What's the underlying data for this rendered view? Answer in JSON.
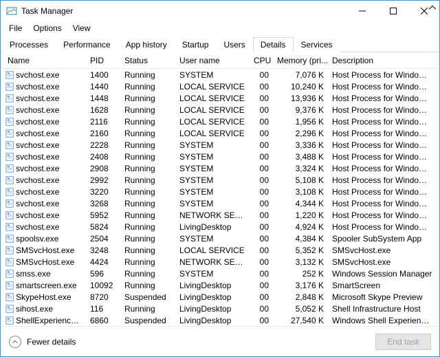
{
  "window": {
    "title": "Task Manager"
  },
  "menu": {
    "file": "File",
    "options": "Options",
    "view": "View"
  },
  "tabs": {
    "processes": "Processes",
    "performance": "Performance",
    "app_history": "App history",
    "startup": "Startup",
    "users": "Users",
    "details": "Details",
    "services": "Services"
  },
  "columns": {
    "name": "Name",
    "pid": "PID",
    "status": "Status",
    "user": "User name",
    "cpu": "CPU",
    "memory": "Memory (pri...",
    "description": "Description"
  },
  "footer": {
    "fewer": "Fewer details",
    "end_task": "End task"
  },
  "processes": [
    {
      "name": "svchost.exe",
      "pid": "1400",
      "status": "Running",
      "user": "SYSTEM",
      "cpu": "00",
      "mem": "7,076 K",
      "desc": "Host Process for Windows Serv"
    },
    {
      "name": "svchost.exe",
      "pid": "1440",
      "status": "Running",
      "user": "LOCAL SERVICE",
      "cpu": "00",
      "mem": "10,240 K",
      "desc": "Host Process for Windows Serv"
    },
    {
      "name": "svchost.exe",
      "pid": "1448",
      "status": "Running",
      "user": "LOCAL SERVICE",
      "cpu": "00",
      "mem": "13,936 K",
      "desc": "Host Process for Windows Serv"
    },
    {
      "name": "svchost.exe",
      "pid": "1628",
      "status": "Running",
      "user": "LOCAL SERVICE",
      "cpu": "00",
      "mem": "9,376 K",
      "desc": "Host Process for Windows Serv"
    },
    {
      "name": "svchost.exe",
      "pid": "2116",
      "status": "Running",
      "user": "LOCAL SERVICE",
      "cpu": "00",
      "mem": "1,956 K",
      "desc": "Host Process for Windows Serv"
    },
    {
      "name": "svchost.exe",
      "pid": "2160",
      "status": "Running",
      "user": "LOCAL SERVICE",
      "cpu": "00",
      "mem": "2,296 K",
      "desc": "Host Process for Windows Serv"
    },
    {
      "name": "svchost.exe",
      "pid": "2228",
      "status": "Running",
      "user": "SYSTEM",
      "cpu": "00",
      "mem": "3,336 K",
      "desc": "Host Process for Windows Serv"
    },
    {
      "name": "svchost.exe",
      "pid": "2408",
      "status": "Running",
      "user": "SYSTEM",
      "cpu": "00",
      "mem": "3,488 K",
      "desc": "Host Process for Windows Serv"
    },
    {
      "name": "svchost.exe",
      "pid": "2908",
      "status": "Running",
      "user": "SYSTEM",
      "cpu": "00",
      "mem": "3,324 K",
      "desc": "Host Process for Windows Serv"
    },
    {
      "name": "svchost.exe",
      "pid": "2992",
      "status": "Running",
      "user": "SYSTEM",
      "cpu": "00",
      "mem": "5,108 K",
      "desc": "Host Process for Windows Serv"
    },
    {
      "name": "svchost.exe",
      "pid": "3220",
      "status": "Running",
      "user": "SYSTEM",
      "cpu": "00",
      "mem": "3,108 K",
      "desc": "Host Process for Windows Serv"
    },
    {
      "name": "svchost.exe",
      "pid": "3268",
      "status": "Running",
      "user": "SYSTEM",
      "cpu": "00",
      "mem": "4,344 K",
      "desc": "Host Process for Windows Serv"
    },
    {
      "name": "svchost.exe",
      "pid": "5952",
      "status": "Running",
      "user": "NETWORK SERVICE",
      "cpu": "00",
      "mem": "1,220 K",
      "desc": "Host Process for Windows Serv"
    },
    {
      "name": "svchost.exe",
      "pid": "5824",
      "status": "Running",
      "user": "LivingDesktop",
      "cpu": "00",
      "mem": "4,924 K",
      "desc": "Host Process for Windows Serv"
    },
    {
      "name": "spoolsv.exe",
      "pid": "2504",
      "status": "Running",
      "user": "SYSTEM",
      "cpu": "00",
      "mem": "4,384 K",
      "desc": "Spooler SubSystem App"
    },
    {
      "name": "SMSvcHost.exe",
      "pid": "3248",
      "status": "Running",
      "user": "LOCAL SERVICE",
      "cpu": "00",
      "mem": "5,352 K",
      "desc": "SMSvcHost.exe"
    },
    {
      "name": "SMSvcHost.exe",
      "pid": "4424",
      "status": "Running",
      "user": "NETWORK SERVICE",
      "cpu": "00",
      "mem": "3,132 K",
      "desc": "SMSvcHost.exe"
    },
    {
      "name": "smss.exe",
      "pid": "596",
      "status": "Running",
      "user": "SYSTEM",
      "cpu": "00",
      "mem": "252 K",
      "desc": "Windows Session Manager"
    },
    {
      "name": "smartscreen.exe",
      "pid": "10092",
      "status": "Running",
      "user": "LivingDesktop",
      "cpu": "00",
      "mem": "3,176 K",
      "desc": "SmartScreen"
    },
    {
      "name": "SkypeHost.exe",
      "pid": "8720",
      "status": "Suspended",
      "user": "LivingDesktop",
      "cpu": "00",
      "mem": "2,848 K",
      "desc": "Microsoft Skype Preview"
    },
    {
      "name": "sihost.exe",
      "pid": "116",
      "status": "Running",
      "user": "LivingDesktop",
      "cpu": "00",
      "mem": "5,052 K",
      "desc": "Shell Infrastructure Host"
    },
    {
      "name": "ShellExperienceHost…",
      "pid": "6860",
      "status": "Suspended",
      "user": "LivingDesktop",
      "cpu": "00",
      "mem": "27,540 K",
      "desc": "Windows Shell Experience Host"
    }
  ]
}
